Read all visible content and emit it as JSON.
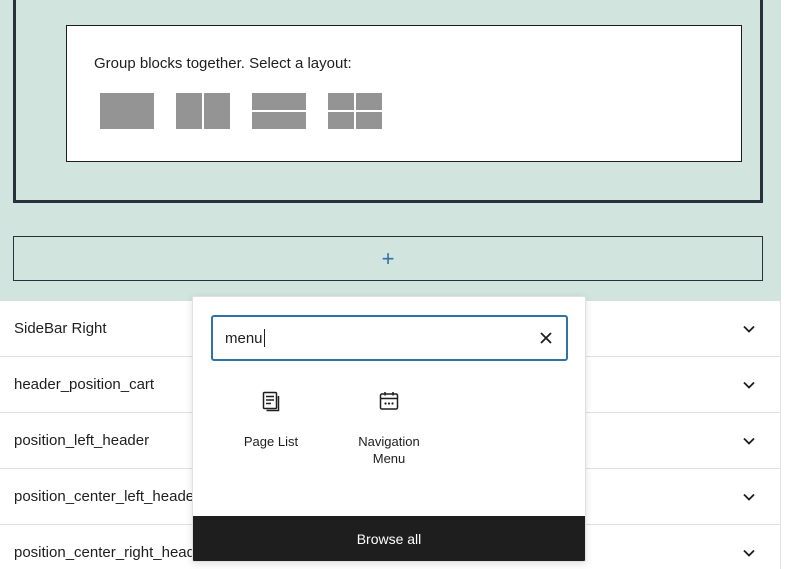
{
  "group_placeholder": {
    "label": "Group blocks together. Select a layout:",
    "variations": [
      "group-icon",
      "row-icon",
      "stack-icon",
      "grid-icon"
    ]
  },
  "appender": {
    "symbol": "+",
    "icon": "plus-icon"
  },
  "rows": [
    {
      "label": "SideBar Right"
    },
    {
      "label": "header_position_cart"
    },
    {
      "label": "position_left_header"
    },
    {
      "label": "position_center_left_header"
    },
    {
      "label": "position_center_right_header"
    }
  ],
  "inserter": {
    "search_value": "menu",
    "clear_icon": "close-icon",
    "results": [
      {
        "label": "Page List",
        "icon": "page-list-icon"
      },
      {
        "label": "Navigation Menu",
        "icon": "navigation-menu-icon"
      }
    ],
    "browse_all_label": "Browse all"
  },
  "colors": {
    "mint_background": "#d1e4dd",
    "accent": "#2f73a6",
    "dark": "#1e1e1e",
    "border_dark": "#28303d",
    "variation_gray": "#949494"
  }
}
